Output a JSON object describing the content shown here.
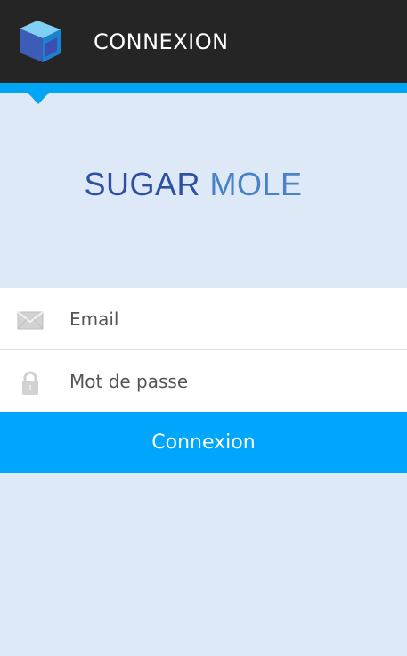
{
  "header": {
    "title": "CONNEXION",
    "logo_icon": "cube-logo-icon",
    "background_color": "#252525",
    "accent_color": "#00a5f5"
  },
  "brand": {
    "word1": "SUGAR",
    "word2": "MOLE",
    "word1_color": "#2f4fa3",
    "word2_color": "#4a82c8"
  },
  "form": {
    "email": {
      "icon": "envelope-icon",
      "placeholder": "Email",
      "value": ""
    },
    "password": {
      "icon": "padlock-icon",
      "placeholder": "Mot de passe",
      "value": ""
    },
    "submit_label": "Connexion",
    "submit_color": "#00a6fb"
  },
  "background_color": "#dde9f6"
}
